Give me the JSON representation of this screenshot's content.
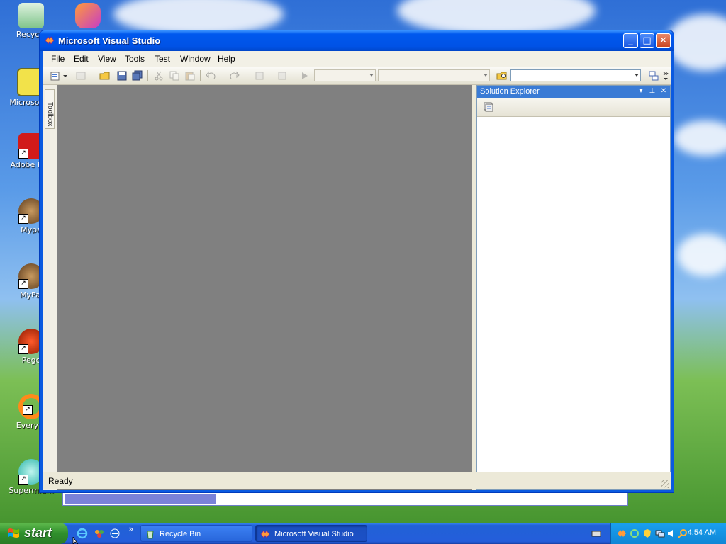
{
  "desktop": {
    "icons": [
      {
        "label": "Recycle"
      },
      {
        "label": "Microsoft C"
      },
      {
        "label": "Adobe Rea"
      },
      {
        "label": "Mypa"
      },
      {
        "label": "MyPal"
      },
      {
        "label": "Pego"
      },
      {
        "label": "Everyth"
      },
      {
        "label": "Supermium"
      }
    ]
  },
  "window": {
    "title": "Microsoft Visual Studio",
    "controls": {
      "minimize": "_",
      "maximize": "□",
      "close": "✕"
    }
  },
  "menubar": {
    "items": [
      "File",
      "Edit",
      "View",
      "Tools",
      "Test",
      "Window",
      "Help"
    ]
  },
  "toolbox": {
    "label": "Toolbox"
  },
  "solution_explorer": {
    "title": "Solution Explorer",
    "controls": {
      "dropdown": "▾",
      "pin": "⊥",
      "close": "✕"
    }
  },
  "statusbar": {
    "text": "Ready"
  },
  "progress": {
    "value": 0.27,
    "color": "#7a82d8"
  },
  "taskbar": {
    "start_label": "start",
    "quick_launch": [
      "ie-icon",
      "msn-icon",
      "outlook-icon"
    ],
    "chevron": "»",
    "tasks": [
      {
        "label": "Recycle Bin",
        "active": false
      },
      {
        "label": "Microsoft Visual Studio",
        "active": true
      }
    ],
    "clock": "4:54 AM"
  },
  "colors": {
    "titlebar": "#0058ee",
    "editor_bg": "#808080",
    "taskbar": "#245edb",
    "start": "#2f8f2c"
  }
}
